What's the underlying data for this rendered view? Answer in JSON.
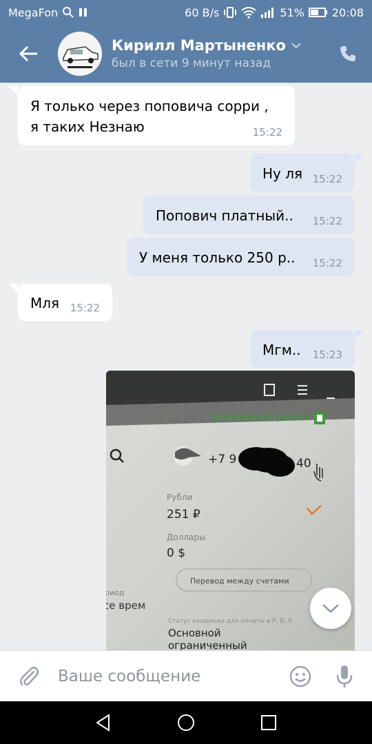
{
  "status_bar": {
    "carrier": "MegaFon",
    "speed": "60 B/s",
    "battery": "51%",
    "time": "20:08",
    "icons": [
      "search-icon",
      "pause-icon",
      "vibrate-icon",
      "wifi-icon",
      "signal-icon",
      "battery-icon"
    ]
  },
  "header": {
    "contact_name": "Кирилл Мартыненко",
    "status": "был в сети 9 минут назад",
    "bg_color": "#5b7fa6"
  },
  "messages": [
    {
      "direction": "in",
      "text_lines": [
        "Я только через поповича сорри ,",
        "я таких Незнаю"
      ],
      "time": "15:22"
    },
    {
      "direction": "out",
      "text": "Ну ля",
      "time": "15:22"
    },
    {
      "direction": "out",
      "text": "Попович платный..",
      "time": "15:22"
    },
    {
      "direction": "out",
      "text": "У меня только 250 р..",
      "time": "15:22"
    },
    {
      "direction": "in",
      "text": "Мля",
      "time": "15:22"
    },
    {
      "direction": "out",
      "text": "Мгм..",
      "time": "15:23"
    }
  ],
  "photo": {
    "secure_mode": "Защищённый режим",
    "phone": "+7 9",
    "phone_tail": "40",
    "rubles_label": "Рубли",
    "rubles_value": "251 ₽",
    "dollars_label": "Доллары",
    "dollars_value": "0 $",
    "transfer_button": "Перевод между счетами",
    "left_fragment_1": "риод",
    "left_fragment_2": "се врем",
    "wallet_status_label": "Статус кошелька для оплаты в Р, Б, К",
    "wallet_status_line1": "Основной",
    "wallet_status_line2": "ограниченный"
  },
  "input": {
    "placeholder": "Ваше сообщение"
  }
}
